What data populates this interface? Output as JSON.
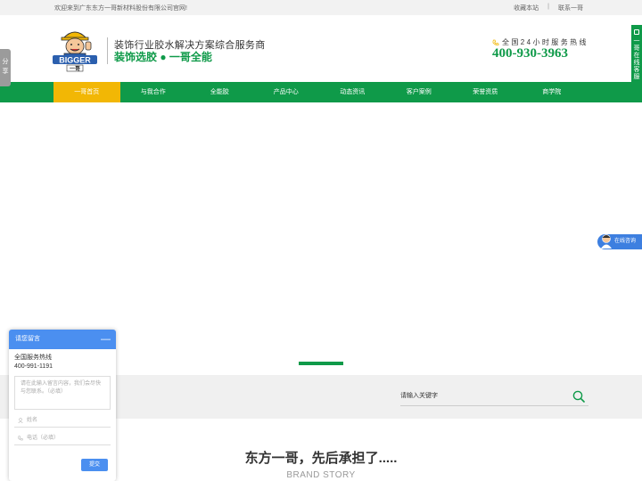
{
  "topbar": {
    "welcome": "欢迎来到广东东方一哥新材料股份有限公司官网!",
    "bookmark": "收藏本站",
    "separator": "|",
    "contact": "联系一哥"
  },
  "header": {
    "logo_text": "BIGGER",
    "logo_sub": "一哥",
    "slogan_line1": "装饰行业胶水解决方案综合服务商",
    "slogan_line2": "装饰选胶 ● 一哥全能",
    "hotline_label": "全国24小时服务热线",
    "hotline_number": "400-930-3963",
    "phone_icon": "phone-icon"
  },
  "nav": {
    "items": [
      {
        "label": "一哥首页",
        "active": true
      },
      {
        "label": "与我合作"
      },
      {
        "label": "全能胶"
      },
      {
        "label": "产品中心"
      },
      {
        "label": "动态资讯"
      },
      {
        "label": "客户案例"
      },
      {
        "label": "荣誉资质"
      },
      {
        "label": "商学院"
      }
    ]
  },
  "search": {
    "placeholder": "请输入关键字",
    "icon": "search-icon"
  },
  "story": {
    "title": "东方一哥，先后承担了.....",
    "subtitle": "BRAND STORY"
  },
  "floating": {
    "share": "分享",
    "online": "一哥在线客服",
    "consult": "在线咨询"
  },
  "message_widget": {
    "title": "请您留言",
    "minimize": "—",
    "hotline_label": "全国服务热线",
    "hotline_number": "400-991-1191",
    "textarea_placeholder": "请在此输入留言内容，我们会尽快与您联系。（必填）",
    "name_placeholder": "姓名",
    "phone_placeholder": "电话（必填）",
    "submit": "提交"
  },
  "colors": {
    "brand_green": "#0f9a49",
    "nav_active": "#f2b705",
    "widget_blue": "#4b8ff0"
  }
}
